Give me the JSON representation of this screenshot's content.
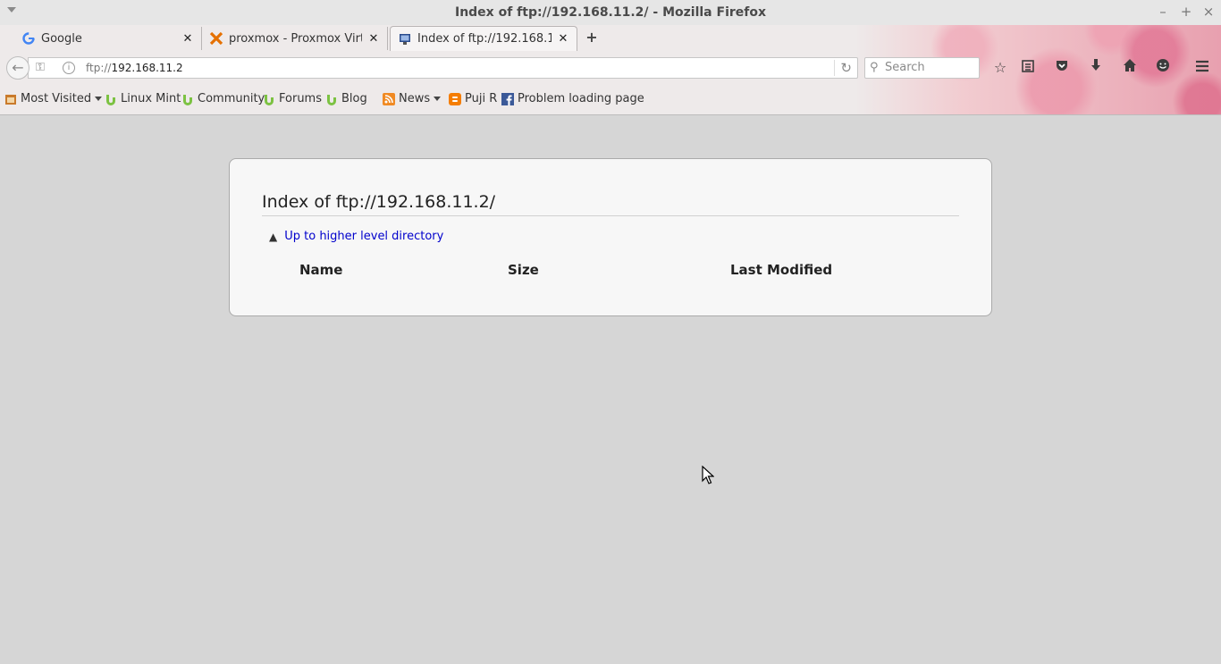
{
  "window": {
    "title": "Index of ftp://192.168.11.2/ - Mozilla Firefox",
    "minimize": "–",
    "maximize": "+",
    "close": "×"
  },
  "tabs": [
    {
      "label": "Google",
      "icon": "google-g-icon",
      "active": false
    },
    {
      "label": "proxmox - Proxmox Virtu...",
      "icon": "proxmox-icon",
      "active": false
    },
    {
      "label": "Index of ftp://192.168.11.2/",
      "icon": "monitor-icon",
      "active": true
    }
  ],
  "navbar": {
    "url_protocol": "ftp://",
    "url_host": "192.168.11.2",
    "search_placeholder": "Search"
  },
  "bookmarks": [
    {
      "label": "Most Visited",
      "icon": "folder-icon",
      "dropdown": true
    },
    {
      "label": "Linux Mint",
      "icon": "mint-leaf-icon"
    },
    {
      "label": "Community",
      "icon": "mint-leaf-icon"
    },
    {
      "label": "Forums",
      "icon": "mint-leaf-icon"
    },
    {
      "label": "Blog",
      "icon": "mint-leaf-icon"
    },
    {
      "label": "News",
      "icon": "rss-icon",
      "dropdown": true
    },
    {
      "label": "Puji R",
      "icon": "blogger-icon"
    },
    {
      "label": "Problem loading page",
      "icon": "facebook-icon"
    }
  ],
  "page": {
    "heading": "Index of ftp://192.168.11.2/",
    "up_link": "Up to higher level directory",
    "columns": [
      "Name",
      "Size",
      "Last Modified"
    ]
  },
  "colors": {
    "link": "#0000cc",
    "content_bg": "#d6d6d6",
    "panel_bg": "#f7f7f7"
  }
}
